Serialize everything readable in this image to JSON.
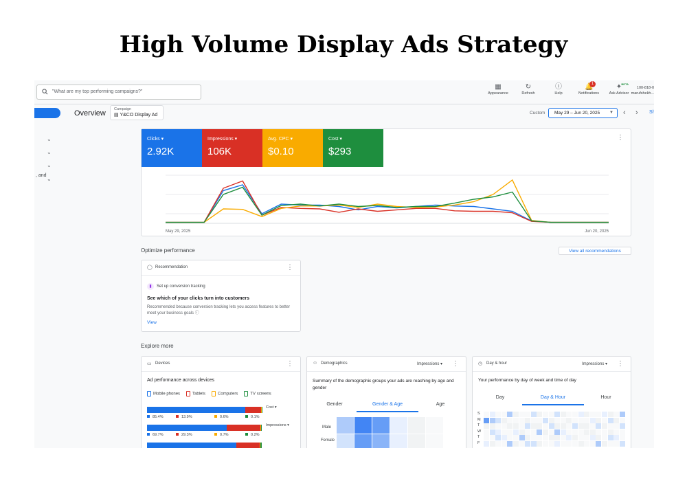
{
  "page_title": "High Volume Display Ads Strategy",
  "search": {
    "placeholder": "\"What are my top performing campaigns?\""
  },
  "toolbar": {
    "items": [
      {
        "label": "Appearance",
        "icon": "appearance-icon"
      },
      {
        "label": "Refresh",
        "icon": "refresh-icon"
      },
      {
        "label": "Help",
        "icon": "help-icon"
      },
      {
        "label": "Notifications",
        "icon": "bell-icon",
        "badge": "1"
      },
      {
        "label": "Ask Advisor",
        "icon": "advisor-icon",
        "tag": "BETA"
      }
    ],
    "account_id": "100-818-0",
    "account_name": "marufshekh..."
  },
  "header": {
    "overview": "Overview",
    "campaign_label": "Campaign",
    "campaign_value": "Y&CO Display Ad",
    "custom_label": "Custom",
    "date_range": "May 29 – Jun 20, 2025",
    "share_label": "Sh"
  },
  "sidebar": {
    "fragment": ", and"
  },
  "metrics": [
    {
      "label": "Clicks",
      "value": "2.92K",
      "color": "#1a73e8"
    },
    {
      "label": "Impressions",
      "value": "106K",
      "color": "#d93025"
    },
    {
      "label": "Avg. CPC",
      "value": "$0.10",
      "color": "#f9ab00"
    },
    {
      "label": "Cost",
      "value": "$293",
      "color": "#1e8e3e"
    }
  ],
  "chart_data": {
    "type": "line",
    "x_start_label": "May 29, 2025",
    "x_end_label": "Jun 20, 2025",
    "grid": true,
    "series": [
      {
        "name": "Clicks",
        "color": "#1a73e8",
        "values": [
          2,
          2,
          2,
          68,
          80,
          20,
          40,
          38,
          38,
          35,
          28,
          35,
          32,
          35,
          38,
          36,
          35,
          30,
          25,
          5,
          2,
          2,
          2,
          2
        ]
      },
      {
        "name": "Impressions",
        "color": "#d93025",
        "values": [
          2,
          2,
          2,
          73,
          88,
          17,
          33,
          31,
          30,
          23,
          30,
          25,
          28,
          31,
          31,
          26,
          25,
          25,
          22,
          4,
          2,
          2,
          2,
          2
        ]
      },
      {
        "name": "Avg. CPC",
        "color": "#f9ab00",
        "values": [
          2,
          2,
          2,
          30,
          29,
          14,
          31,
          36,
          36,
          38,
          33,
          40,
          35,
          33,
          34,
          38,
          45,
          60,
          90,
          6,
          2,
          2,
          2,
          2
        ]
      },
      {
        "name": "Cost",
        "color": "#1e8e3e",
        "values": [
          2,
          2,
          2,
          60,
          75,
          17,
          37,
          40,
          36,
          40,
          35,
          37,
          33,
          35,
          35,
          42,
          50,
          55,
          65,
          5,
          2,
          2,
          2,
          2
        ]
      }
    ]
  },
  "optimize": {
    "title": "Optimize performance",
    "view_all": "View all recommendations",
    "card_title": "Recommendation",
    "item_title": "Set up conversion tracking",
    "heading": "See which of your clicks turn into customers",
    "body": "Recommended because conversion tracking lets you access features to better meet your business goals",
    "link": "View"
  },
  "explore": {
    "title": "Explore more",
    "devices": {
      "title": "Devices",
      "subtitle": "Ad performance across devices",
      "legend": [
        {
          "label": "Mobile phones",
          "color": "#1a73e8"
        },
        {
          "label": "Tablets",
          "color": "#d93025"
        },
        {
          "label": "Computers",
          "color": "#f9ab00"
        },
        {
          "label": "TV screens",
          "color": "#1e8e3e"
        }
      ],
      "rows": [
        {
          "metric": "Cost",
          "shares": [
            85.4,
            13.9,
            0.6,
            0.1
          ],
          "labels": [
            "85.4%",
            "13.9%",
            "0.6%",
            "0.1%"
          ]
        },
        {
          "metric": "Impressions",
          "shares": [
            69.7,
            29.3,
            0.7,
            0.2
          ],
          "labels": [
            "69.7%",
            "29.3%",
            "0.7%",
            "0.2%"
          ]
        },
        {
          "metric": "",
          "shares": [
            78,
            20,
            1,
            1
          ],
          "labels": [
            "",
            "",
            "",
            ""
          ]
        }
      ]
    },
    "demographics": {
      "title": "Demographics",
      "select": "Impressions",
      "summary": "Summary of the demographic groups your ads are reaching by age and gender",
      "tabs": [
        "Gender",
        "Gender & Age",
        "Age"
      ],
      "active_tab": 1,
      "rows": [
        "Male",
        "Female"
      ]
    },
    "dayhour": {
      "title": "Day & hour",
      "select": "Impressions",
      "summary": "Your performance by day of week and time of day",
      "tabs": [
        "Day",
        "Day & Hour",
        "Hour"
      ],
      "active_tab": 1,
      "days": [
        "S",
        "M",
        "T",
        "W",
        "T",
        "F"
      ]
    }
  }
}
